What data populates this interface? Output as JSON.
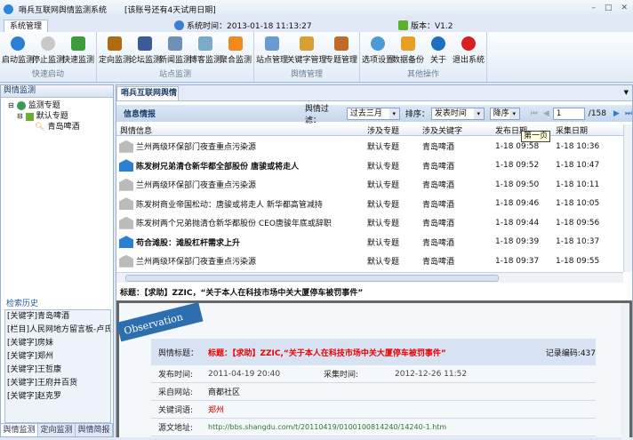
{
  "window": {
    "title": "哨兵互联网舆情监测系统",
    "trial": "[该账号还有4天试用日期]",
    "status_time": "系统时间：2013-01-18 11:13:27",
    "version": "版本：V1.2"
  },
  "tabs": {
    "system": "系统管理"
  },
  "ribbon": [
    {
      "label": "快速启动",
      "buttons": [
        {
          "label": "启动监测",
          "icon": "play-icon",
          "color": "#2a7fd4"
        },
        {
          "label": "停止监测",
          "icon": "pause-icon",
          "color": "#c8c8c8"
        },
        {
          "label": "快速监测",
          "icon": "globe-search-icon",
          "color": "#3c9c3c"
        }
      ]
    },
    {
      "label": "站点监测",
      "buttons": [
        {
          "label": "定向监测",
          "icon": "tv-icon",
          "color": "#b06a12"
        },
        {
          "label": "论坛监测",
          "icon": "facebook-icon",
          "color": "#3b5a9a"
        },
        {
          "label": "新闻监测",
          "icon": "robot-icon",
          "color": "#6f8fb8"
        },
        {
          "label": "博客监测",
          "icon": "blog-icon",
          "color": "#7aa9c9"
        },
        {
          "label": "聚合监测",
          "icon": "rss-icon",
          "color": "#f08a1c"
        }
      ]
    },
    {
      "label": "舆情管理",
      "buttons": [
        {
          "label": "站点管理",
          "icon": "home-icon",
          "color": "#6a9bd0"
        },
        {
          "label": "关键字管理",
          "icon": "key-icon",
          "color": "#d8a030"
        },
        {
          "label": "专题管理",
          "icon": "clipboard-icon",
          "color": "#c06a2a"
        }
      ]
    },
    {
      "label": "其他操作",
      "buttons": [
        {
          "label": "选项设置",
          "icon": "gear-icon",
          "color": "#4a9ad8"
        },
        {
          "label": "数据备份",
          "icon": "lock-icon",
          "color": "#e8a020"
        },
        {
          "label": "关于",
          "icon": "info-icon",
          "color": "#1f6fc0"
        },
        {
          "label": "退出系统",
          "icon": "power-icon",
          "color": "#d82020"
        }
      ]
    }
  ],
  "left": {
    "title": "舆情监测",
    "tree": [
      "监测专题",
      "默认专题",
      "青岛啤酒"
    ],
    "history_title": "检索历史",
    "history": [
      "[关键字]青岛啤酒",
      "[栏目]人民网地方留言板-卢氏",
      "[关键字]房妹",
      "[关键字]郑州",
      "[关键字]王哲康",
      "[关键字]王府井百货",
      "[关键字]赵克罗"
    ],
    "bottom_tabs": [
      "舆情监测",
      "定向监测",
      "舆情简报"
    ]
  },
  "main": {
    "tab": "哨兵互联网舆情",
    "section": "信息情报",
    "filter_label": "舆情过滤：",
    "filter_value": "过去三月",
    "sort_label": "排序：",
    "sort_value": "发表时间",
    "order_value": "降序",
    "page": "1",
    "total_pages": "/158",
    "tooltip": "第一页",
    "columns": [
      "舆情信息",
      "涉及专题",
      "涉及关键字",
      "发布日期",
      "采集日期"
    ],
    "rows": [
      {
        "title": "兰州两级环保部门夜查重点污染源",
        "topic": "默认专题",
        "keyword": "青岛啤酒",
        "pub": "1-18 09:58",
        "col": "1-18 10:36",
        "unread": false
      },
      {
        "title": "陈发树兄弟清仓新华都全部股份 唐骏或将走人",
        "topic": "默认专题",
        "keyword": "青岛啤酒",
        "pub": "1-18 09:52",
        "col": "1-18 10:47",
        "unread": true
      },
      {
        "title": "兰州两级环保部门夜查重点污染源",
        "topic": "默认专题",
        "keyword": "青岛啤酒",
        "pub": "1-18 09:50",
        "col": "1-18 10:11",
        "unread": false
      },
      {
        "title": "陈发树商业帝国松动：唐骏或将走人 新华都高管减持",
        "topic": "默认专题",
        "keyword": "青岛啤酒",
        "pub": "1-18 09:46",
        "col": "1-18 10:05",
        "unread": false
      },
      {
        "title": "陈发树两个兄弟抛清仓新华都股份 CEO唐骏年底或辞职",
        "topic": "默认专题",
        "keyword": "青岛啤酒",
        "pub": "1-18 09:44",
        "col": "1-18 09:56",
        "unread": false
      },
      {
        "title": "苟合滩股：滩股杠杆需求上升",
        "topic": "默认专题",
        "keyword": "青岛啤酒",
        "pub": "1-18 09:39",
        "col": "1-18 10:37",
        "unread": true
      },
      {
        "title": "兰州两级环保部门夜查重点污染源",
        "topic": "默认专题",
        "keyword": "青岛啤酒",
        "pub": "1-18 09:37",
        "col": "1-18 09:55",
        "unread": false
      }
    ],
    "selected_title": "标题：【求助】ZZIC，“关于本人在科技市场中关大厦停车被罚事件”"
  },
  "detail": {
    "banner": "Observation",
    "title_label": "舆情标题：",
    "title": "标题：【求助】ZZIC,“关于本人在科技市场中关大厦停车被罚事件”",
    "record_label": "记录编码:437",
    "pub_label": "发布时间:",
    "pub": "2011-04-19 20:40",
    "col_label": "采集时间:",
    "col": "2012-12-26 11:52",
    "site_label": "采自网站:",
    "site": "商都社区",
    "kw_label": "关键词语:",
    "kw": "郑州",
    "url_label": "源文地址:",
    "url": "http://bbs.shangdu.com/t/20110419/0100100814240/14240-1.htm"
  }
}
